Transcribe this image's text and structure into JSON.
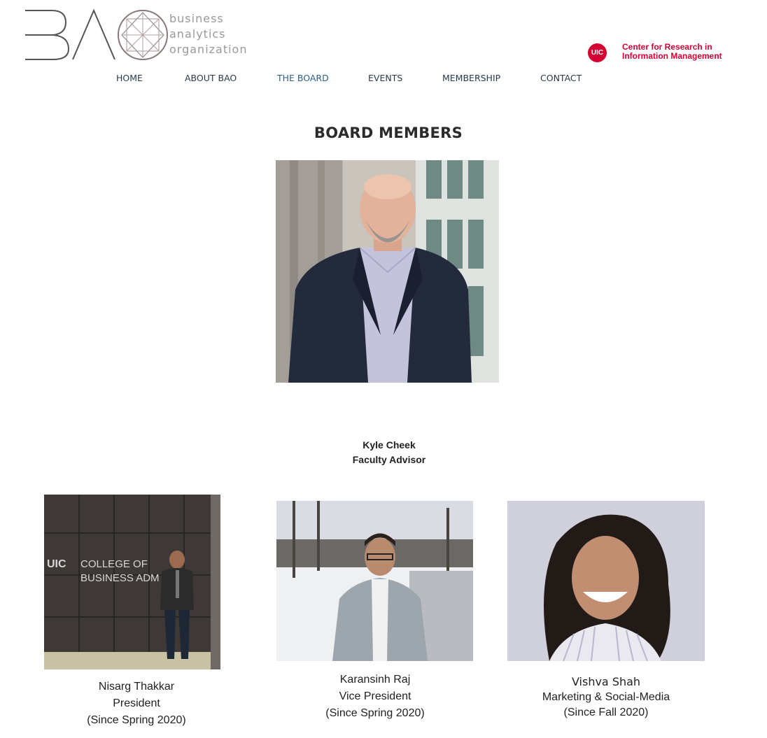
{
  "header": {
    "logo": {
      "mark_text": "BAO",
      "words": [
        "business",
        "analytics",
        "organization"
      ]
    },
    "partner": {
      "badge": "UIC",
      "lines": [
        "Center for Research in",
        "Information Management"
      ]
    }
  },
  "nav": {
    "items": [
      {
        "label": "HOME"
      },
      {
        "label": "ABOUT BAO"
      },
      {
        "label": "THE BOARD"
      },
      {
        "label": "EVENTS"
      },
      {
        "label": "MEMBERSHIP"
      },
      {
        "label": "CONTACT"
      }
    ],
    "active": "THE BOARD"
  },
  "main": {
    "title": "BOARD MEMBERS",
    "advisor": {
      "name": "Kyle Cheek",
      "role": "Faculty Advisor"
    },
    "members": [
      {
        "name": "Nisarg Thakkar",
        "role": "President",
        "since": "(Since Spring 2020)",
        "photo_sign": [
          "UIC",
          "COLLEGE OF",
          "BUSINESS ADM"
        ]
      },
      {
        "name": "Karansinh Raj",
        "role": "Vice President",
        "since": "(Since Spring 2020)"
      },
      {
        "name": "Vishva Shah",
        "role": "Marketing & Social-Media",
        "since": "(Since Fall 2020)"
      }
    ]
  }
}
